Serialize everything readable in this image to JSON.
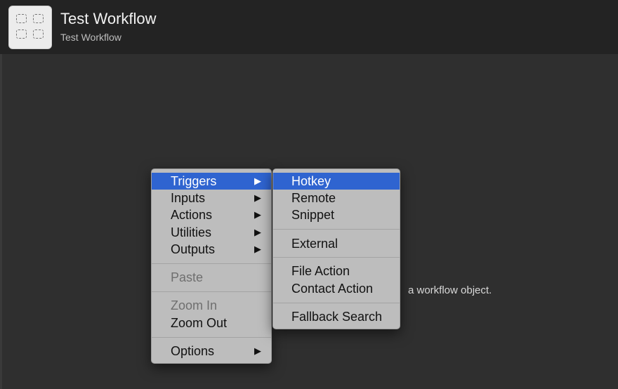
{
  "header": {
    "title": "Test Workflow",
    "subtitle": "Test Workflow",
    "icon": "grid-placeholder-icon"
  },
  "canvas": {
    "hint_text": "a workflow object."
  },
  "main_menu": {
    "items": [
      {
        "label": "Triggers",
        "has_submenu": true,
        "selected": true
      },
      {
        "label": "Inputs",
        "has_submenu": true
      },
      {
        "label": "Actions",
        "has_submenu": true
      },
      {
        "label": "Utilities",
        "has_submenu": true
      },
      {
        "label": "Outputs",
        "has_submenu": true
      },
      {
        "label": "Paste",
        "disabled": true
      },
      {
        "label": "Zoom In",
        "disabled": true
      },
      {
        "label": "Zoom Out"
      },
      {
        "label": "Options",
        "has_submenu": true
      }
    ],
    "arrow_glyph": "▶"
  },
  "sub_menu": {
    "items": [
      {
        "label": "Hotkey",
        "selected": true
      },
      {
        "label": "Remote"
      },
      {
        "label": "Snippet"
      },
      {
        "label": "External"
      },
      {
        "label": "File Action"
      },
      {
        "label": "Contact Action"
      },
      {
        "label": "Fallback Search"
      }
    ]
  },
  "colors": {
    "selection": "#2f64d0",
    "menu_background": "#bdbdbd",
    "canvas_background": "#2f2f2f",
    "header_background": "#232323"
  }
}
